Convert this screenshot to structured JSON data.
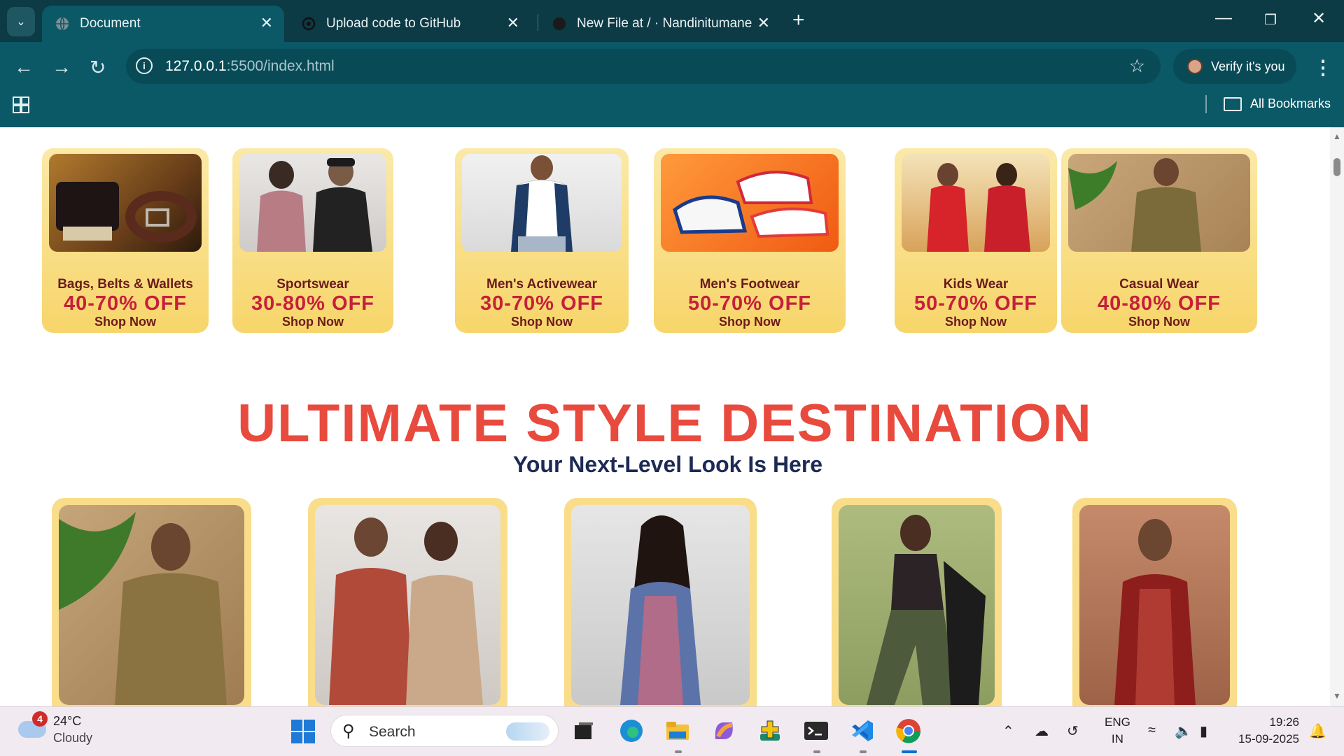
{
  "browser": {
    "tabs": [
      {
        "title": "Document"
      },
      {
        "title": "Upload code to GitHub"
      },
      {
        "title": "New File at / · Nandinitumane/I"
      }
    ],
    "url_host": "127.0.0.1",
    "url_path": ":5500/index.html",
    "profile_label": "Verify it's you",
    "bookmarks_label": "All Bookmarks"
  },
  "offers": [
    {
      "category": "Bags, Belts & Wallets",
      "discount": "40-70% OFF",
      "cta": "Shop Now"
    },
    {
      "category": "Sportswear",
      "discount": "30-80% OFF",
      "cta": "Shop Now"
    },
    {
      "category": "Men's Activewear",
      "discount": "30-70% OFF",
      "cta": "Shop Now"
    },
    {
      "category": "Men's Footwear",
      "discount": "50-70% OFF",
      "cta": "Shop Now"
    },
    {
      "category": "Kids Wear",
      "discount": "50-70% OFF",
      "cta": "Shop Now"
    },
    {
      "category": "Casual Wear",
      "discount": "40-80% OFF",
      "cta": "Shop Now"
    }
  ],
  "section": {
    "headline": "ULTIMATE STYLE DESTINATION",
    "subheadline": "Your Next-Level Look Is Here"
  },
  "taskbar": {
    "weather_badge": "4",
    "temperature": "24°C",
    "condition": "Cloudy",
    "search_label": "Search",
    "language_top": "ENG",
    "language_bottom": "IN",
    "time": "19:26",
    "date": "15-09-2025"
  },
  "colors": {
    "browser_dark": "#0c3a45",
    "browser_toolbar": "#0b5866",
    "headline": "#e84a3e",
    "subheadline": "#1d2a55",
    "card_gold": "#f7d56a",
    "offer_red": "#c5203a"
  }
}
